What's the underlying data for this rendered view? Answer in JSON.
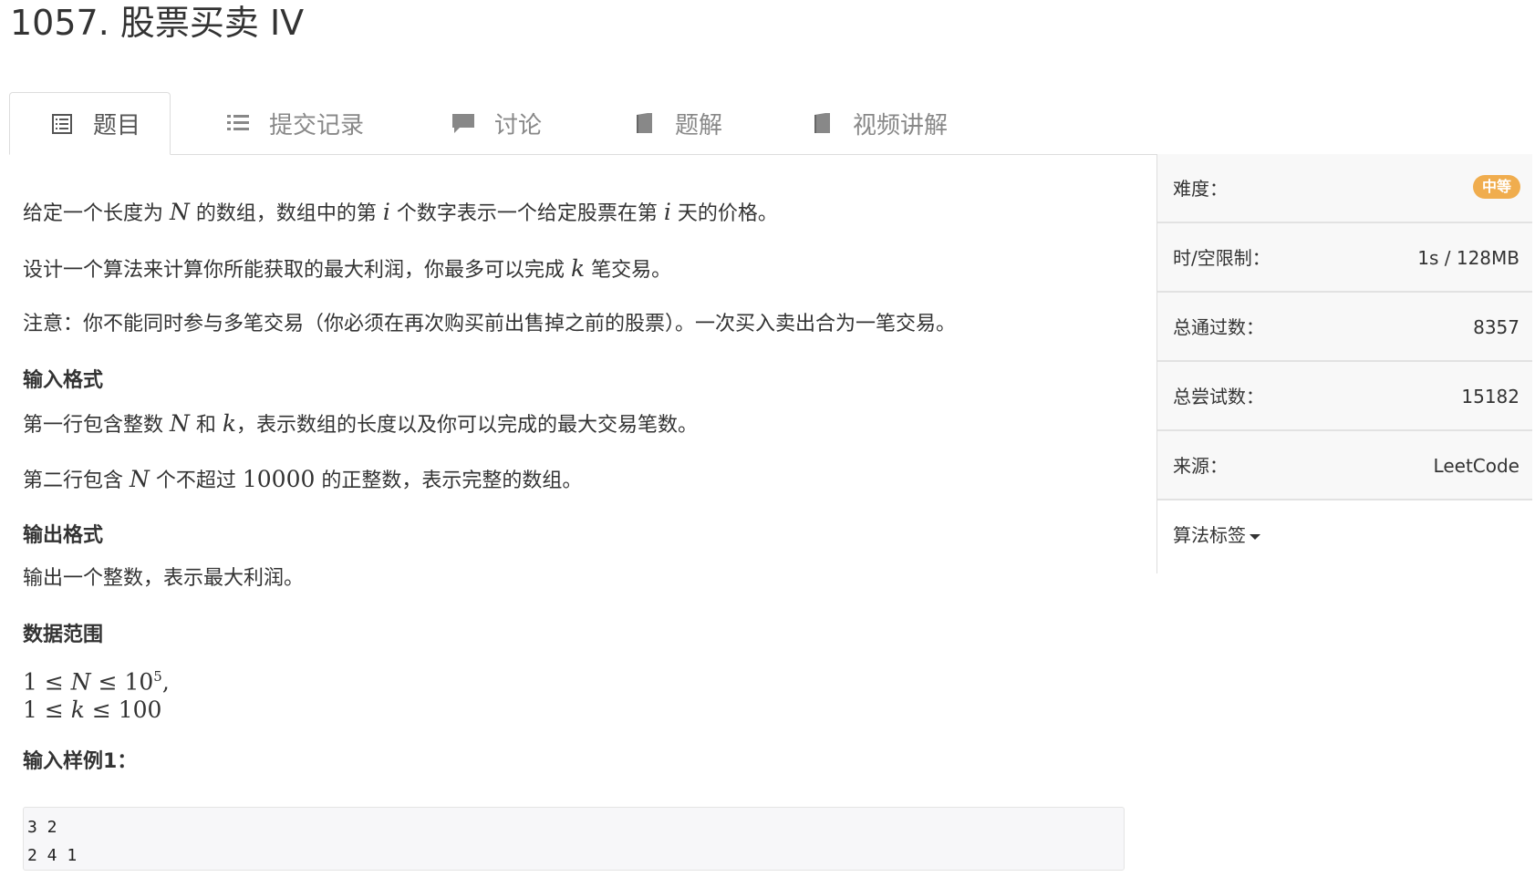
{
  "page_title": "1057. 股票买卖 IV",
  "tabs": [
    {
      "label": "题目",
      "icon": "list-box-icon",
      "active": true
    },
    {
      "label": "提交记录",
      "icon": "list-icon"
    },
    {
      "label": "讨论",
      "icon": "comment-icon"
    },
    {
      "label": "题解",
      "icon": "book-icon"
    },
    {
      "label": "视频讲解",
      "icon": "book-icon"
    }
  ],
  "problem": {
    "desc1": {
      "a": "给定一个长度为 ",
      "n": "N",
      "b": " 的数组，数组中的第 ",
      "i1": "i",
      "c": " 个数字表示一个给定股票在第 ",
      "i2": "i",
      "d": " 天的价格。"
    },
    "desc2": {
      "a": "设计一个算法来计算你所能获取的最大利润，你最多可以完成 ",
      "k": "k",
      "b": " 笔交易。"
    },
    "desc3": "注意：你不能同时参与多笔交易（你必须在再次购买前出售掉之前的股票）。一次买入卖出合为一笔交易。",
    "input_heading": "输入格式",
    "input1": {
      "a": "第一行包含整数 ",
      "n": "N",
      "b": " 和 ",
      "k": "k",
      "c": "，表示数组的长度以及你可以完成的最大交易笔数。"
    },
    "input2": {
      "a": "第二行包含 ",
      "n": "N",
      "b": " 个不超过 ",
      "num": "10000",
      "c": " 的正整数，表示完整的数组。"
    },
    "output_heading": "输出格式",
    "output1": "输出一个整数，表示最大利润。",
    "range_heading": "数据范围",
    "range1": {
      "lhs": "1 ≤ ",
      "var": "N",
      "op": " ≤ 10",
      "exp": "5",
      "tail": ","
    },
    "range2": {
      "lhs": "1 ≤ ",
      "var": "k",
      "op": " ≤ 100"
    },
    "sample_heading": "输入样例1：",
    "sample_input": "3 2\n2 4 1"
  },
  "sidebar": {
    "difficulty_label": "难度：",
    "difficulty_value": "中等",
    "difficulty_color": "#f0ad4e",
    "limit_label": "时/空限制：",
    "limit_value": "1s / 128MB",
    "passed_label": "总通过数：",
    "passed_value": "8357",
    "attempts_label": "总尝试数：",
    "attempts_value": "15182",
    "source_label": "来源：",
    "source_value": "LeetCode",
    "tags_label": "算法标签"
  }
}
